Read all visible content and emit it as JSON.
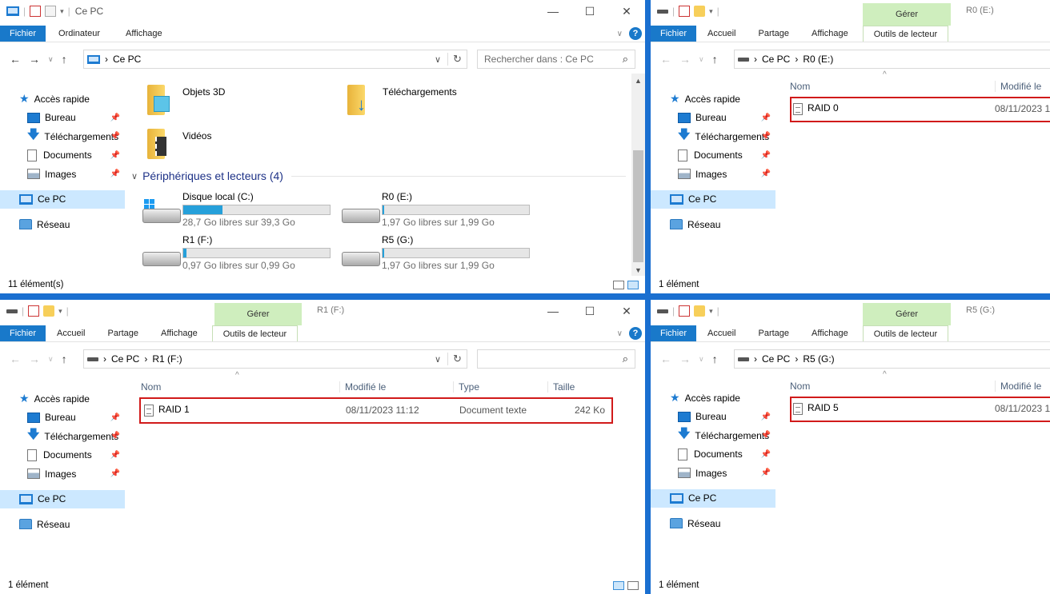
{
  "common": {
    "fichier": "Fichier",
    "accueil": "Accueil",
    "partage": "Partage",
    "affichage": "Affichage",
    "ordinateur": "Ordinateur",
    "gerer": "Gérer",
    "outils_lecteur": "Outils de lecteur",
    "ce_pc": "Ce PC",
    "sidebar": {
      "acces_rapide": "Accès rapide",
      "bureau": "Bureau",
      "telechargements": "Téléchargements",
      "documents": "Documents",
      "images": "Images",
      "ce_pc": "Ce PC",
      "reseau": "Réseau"
    },
    "cols": {
      "nom": "Nom",
      "modifie": "Modifié le",
      "type": "Type",
      "taille": "Taille"
    }
  },
  "win_pc": {
    "title": "Ce PC",
    "search_placeholder": "Rechercher dans : Ce PC",
    "folders": [
      {
        "name": "Objets 3D"
      },
      {
        "name": "Téléchargements"
      },
      {
        "name": "Vidéos"
      }
    ],
    "devices_header": "Périphériques et lecteurs (4)",
    "drives": [
      {
        "name": "Disque local (C:)",
        "free": "28,7 Go libres sur 39,3 Go",
        "used_fraction": 0.27
      },
      {
        "name": "R0 (E:)",
        "free": "1,97 Go libres sur 1,99 Go",
        "used_fraction": 0.01
      },
      {
        "name": "R1 (F:)",
        "free": "0,97 Go libres sur 0,99 Go",
        "used_fraction": 0.02
      },
      {
        "name": "R5 (G:)",
        "free": "1,97 Go libres sur 1,99 Go",
        "used_fraction": 0.01
      }
    ],
    "status": "11 élément(s)"
  },
  "win_e": {
    "title": "R0 (E:)",
    "drive": "R0 (E:)",
    "file": {
      "name": "RAID 0",
      "modified": "08/11/2023 1"
    },
    "status": "1 élément"
  },
  "win_f": {
    "title": "R1 (F:)",
    "drive": "R1 (F:)",
    "file": {
      "name": "RAID 1",
      "modified": "08/11/2023 11:12",
      "type": "Document texte",
      "size": "242 Ko"
    },
    "status": "1 élément"
  },
  "win_g": {
    "title": "R5 (G:)",
    "drive": "R5 (G:)",
    "file": {
      "name": "RAID 5",
      "modified": "08/11/2023 1"
    },
    "status": "1 élément"
  }
}
